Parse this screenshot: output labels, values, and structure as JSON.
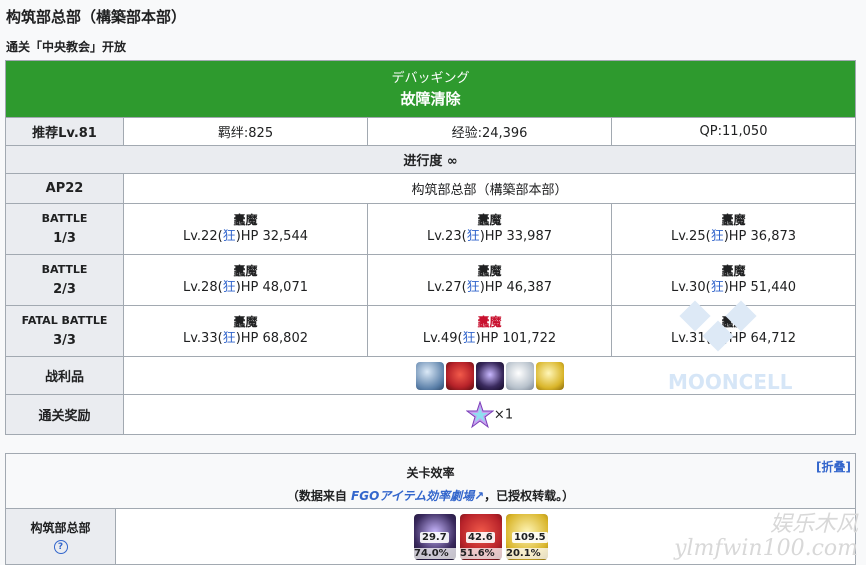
{
  "page_title": "构筑部总部（構築部本部）",
  "unlock_text": "通关「中央教会」开放",
  "quest": {
    "name_jp": "デバッギング",
    "name_cn": "故障清除",
    "recommend": "推荐Lv.81",
    "bond": "羁绊:825",
    "exp": "经验:24,396",
    "qp": "QP:11,050",
    "progress": "进行度 ∞",
    "ap": "AP22",
    "location": "构筑部总部（構築部本部）",
    "battles": [
      {
        "label1": "BATTLE",
        "label2": "1/3",
        "enemies": [
          {
            "name": "蠹魔",
            "lv": "Lv.22(",
            "cls": "狂",
            "hp": ")HP 32,544",
            "highlight": false
          },
          {
            "name": "蠹魔",
            "lv": "Lv.23(",
            "cls": "狂",
            "hp": ")HP 33,987",
            "highlight": false
          },
          {
            "name": "蠹魔",
            "lv": "Lv.25(",
            "cls": "狂",
            "hp": ")HP 36,873",
            "highlight": false
          }
        ]
      },
      {
        "label1": "BATTLE",
        "label2": "2/3",
        "enemies": [
          {
            "name": "蠹魔",
            "lv": "Lv.28(",
            "cls": "狂",
            "hp": ")HP 48,071",
            "highlight": false
          },
          {
            "name": "蠹魔",
            "lv": "Lv.27(",
            "cls": "狂",
            "hp": ")HP 46,387",
            "highlight": false
          },
          {
            "name": "蠹魔",
            "lv": "Lv.30(",
            "cls": "狂",
            "hp": ")HP 51,440",
            "highlight": false
          }
        ]
      },
      {
        "label1": "FATAL BATTLE",
        "label2": "3/3",
        "enemies": [
          {
            "name": "蠹魔",
            "lv": "Lv.33(",
            "cls": "狂",
            "hp": ")HP 68,802",
            "highlight": false
          },
          {
            "name": "蠹魔",
            "lv": "Lv.49(",
            "cls": "狂",
            "hp": ")HP 101,722",
            "highlight": true
          },
          {
            "name": "蠹魔",
            "lv": "Lv.31(",
            "cls": "狂",
            "hp": ")HP 64,712",
            "highlight": false
          }
        ]
      }
    ],
    "drops_label": "战利品",
    "drops": [
      {
        "icon": "blue-crystal-icon",
        "color": "#5a7fa8"
      },
      {
        "icon": "red-heart-icon",
        "color": "#b8232a"
      },
      {
        "icon": "purple-orb-icon",
        "color": "#3a2a5e"
      },
      {
        "icon": "silver-gem-icon",
        "color": "#b8c2cc"
      },
      {
        "icon": "gold-gem-icon",
        "color": "#d9b52a"
      }
    ],
    "reward_label": "通关奖励",
    "reward_count": "×1"
  },
  "efficiency": {
    "title": "关卡效率",
    "fold": "[折叠]",
    "source_prefix": "（数据来自 ",
    "source_link": "FGOアイテム効率劇場",
    "source_suffix": "，已授权转载。）",
    "row_label": "构筑部总部",
    "items": [
      {
        "icon": "purple-orb-icon",
        "value": "29.7",
        "percent": "74.0%",
        "color": "#3a2a5e"
      },
      {
        "icon": "red-heart-icon",
        "value": "42.6",
        "percent": "51.6%",
        "color": "#b8232a"
      },
      {
        "icon": "gold-gem-icon",
        "value": "109.5",
        "percent": "20.1%",
        "color": "#d9b52a"
      }
    ]
  },
  "watermark": {
    "brand": "MOONCELL",
    "site1": "娱乐木风",
    "site2": "ylmfwin100.com"
  }
}
